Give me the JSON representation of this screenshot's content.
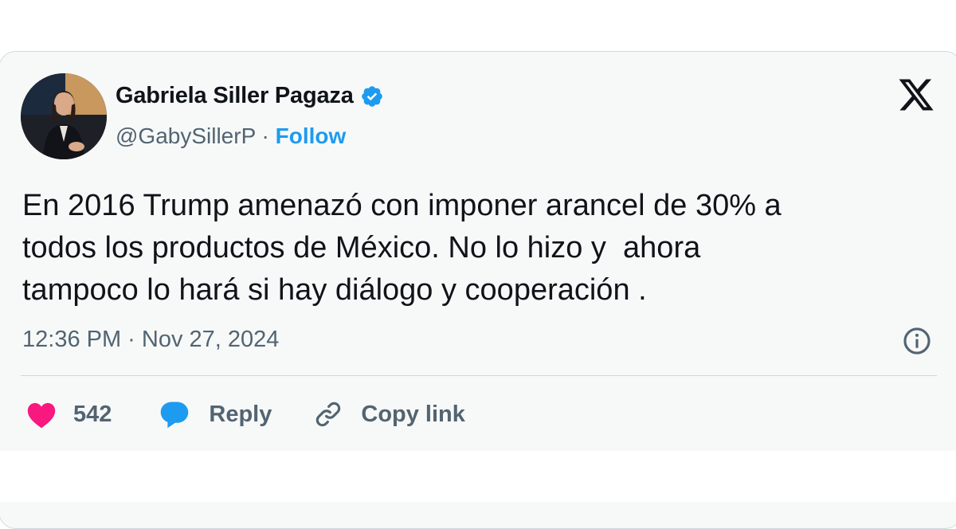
{
  "author": {
    "name": "Gabriela Siller Pagaza",
    "handle": "@GabySillerP",
    "separator": " · ",
    "follow_label": "Follow",
    "verified": true,
    "avatar": "profile-photo"
  },
  "tweet": {
    "text": "En 2016 Trump amenazó con imponer arancel de 30% a\ntodos los productos de México. No lo hizo y  ahora\ntampoco lo hará si hay diálogo y cooperación .",
    "timestamp": "12:36 PM · Nov 27, 2024"
  },
  "actions": {
    "like_count": "542",
    "reply_label": "Reply",
    "copy_label": "Copy link"
  },
  "icons": {
    "brand": "x-logo-icon",
    "verified": "verified-badge-icon",
    "info": "info-icon",
    "like": "heart-icon",
    "reply": "reply-bubble-icon",
    "copy": "link-icon"
  },
  "colors": {
    "accent": "#1d9bf0",
    "like": "#f91880",
    "text": "#0f1419",
    "muted": "#536471",
    "card_bg": "#f7f9f9"
  }
}
